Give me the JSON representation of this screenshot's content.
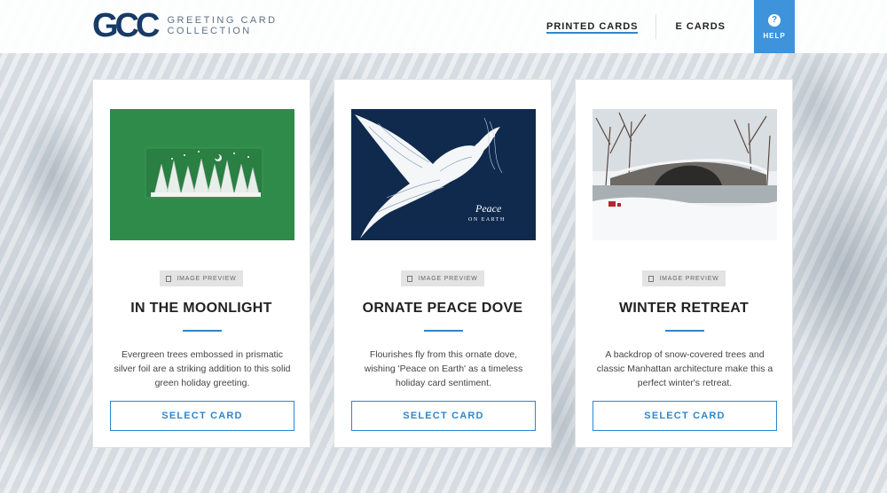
{
  "brand": {
    "logo_mark": "GCC",
    "logo_line1": "GREETING CARD",
    "logo_line2": "COLLECTION"
  },
  "nav": {
    "printed_cards": "PRINTED CARDS",
    "e_cards": "E CARDS",
    "help_icon": "?",
    "help_label": "HELP",
    "active_tab": "PRINTED CARDS"
  },
  "cards": [
    {
      "preview_label": "IMAGE PREVIEW",
      "title": "IN THE MOONLIGHT",
      "description": "Evergreen trees embossed in prismatic silver foil are a striking addition to this solid green holiday greeting.",
      "button": "SELECT CARD",
      "image_theme": "green-card-silver-trees"
    },
    {
      "preview_label": "IMAGE PREVIEW",
      "title": "ORNATE PEACE DOVE",
      "description": "Flourishes fly from this ornate dove, wishing 'Peace on Earth' as a timeless holiday card sentiment.",
      "button": "SELECT CARD",
      "image_text_line1": "Peace",
      "image_text_line2": "ON EARTH",
      "image_theme": "navy-card-white-dove"
    },
    {
      "preview_label": "IMAGE PREVIEW",
      "title": "WINTER RETREAT",
      "description": "A backdrop of snow-covered trees and classic Manhattan architecture make this a perfect winter's retreat.",
      "button": "SELECT CARD",
      "image_theme": "snowy-bridge-photo"
    }
  ],
  "colors": {
    "accent": "#2d86cf",
    "brand_navy": "#173a66",
    "help_bg": "#3e93db",
    "card1_green": "#2e8b4a",
    "card2_navy": "#0f2a4d"
  }
}
